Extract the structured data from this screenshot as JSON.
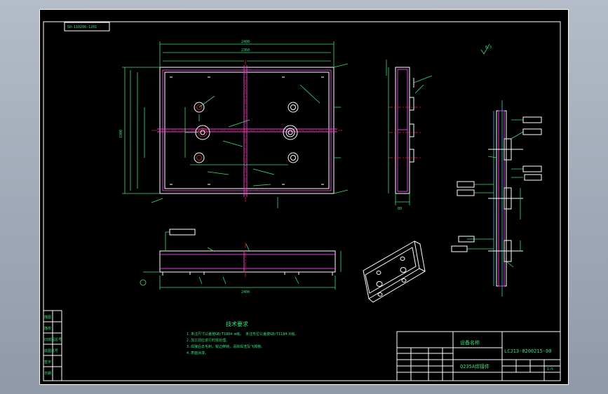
{
  "drawing": {
    "block_label": "SO-110206-1201",
    "roughness": "6.3",
    "tech_title": "技术要求",
    "notes": [
      "1.未注尺寸公差按GB/T1804-m级。 未注形位公差按GB/T1184-K级。",
      "2.加工前应进行时效处理。",
      "3.焊接后去毛刺，锐边倒钝，清除焊渣及飞溅物。",
      "4.表面涂漆。"
    ],
    "title_block": {
      "org": "设备名称",
      "part_name": "Q235A焊接件",
      "drawing_no": "LCJ13-0200215-00",
      "scale": "1:5"
    },
    "left_column": [
      "描图",
      "描校",
      "旧底图总号",
      "底图总号",
      "签字",
      "日期"
    ],
    "dims": {
      "overall_width": "2400",
      "inner_width": "2360",
      "height_main": "1900",
      "thickness": "80",
      "ft_total": "2400"
    }
  },
  "colors": {
    "background": "#000000",
    "outline": "#ffffff",
    "dimension": "#39e07a",
    "centerline": "#e02020",
    "weld": "#e23be2",
    "tolerance": "#2fd4e8"
  }
}
